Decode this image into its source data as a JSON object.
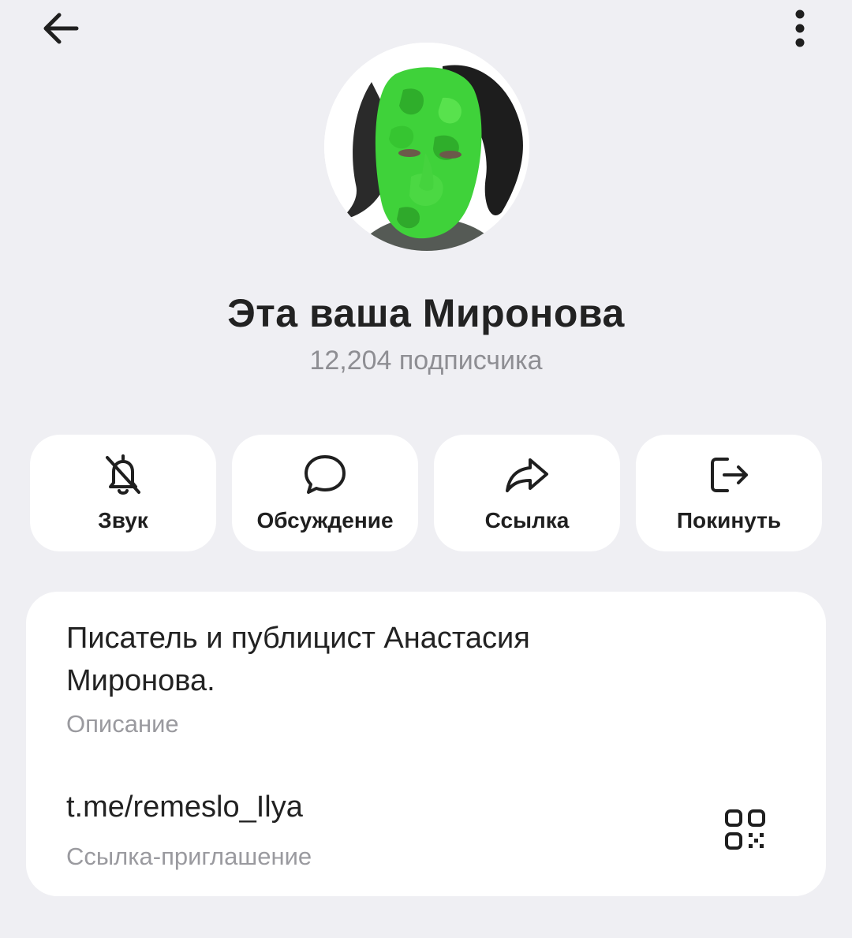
{
  "header": {
    "back_icon": "arrow-left-icon",
    "more_icon": "more-vertical-icon"
  },
  "channel": {
    "name": "Эта ваша Миронова",
    "subscribers": "12,204 подписчика"
  },
  "actions": [
    {
      "label": "Звук",
      "icon": "bell-off-icon"
    },
    {
      "label": "Обсуждение",
      "icon": "chat-bubble-icon"
    },
    {
      "label": "Ссылка",
      "icon": "share-icon"
    },
    {
      "label": "Покинуть",
      "icon": "exit-icon"
    }
  ],
  "info": {
    "description": "Писатель и публицист Анастасия Миронова.",
    "description_caption": "Описание",
    "link": "t.me/remeslo_Ilya",
    "link_caption": "Ссылка-приглашение",
    "qr_icon": "qr-code-icon"
  },
  "colors": {
    "background": "#efeff3",
    "card": "#ffffff",
    "text_primary": "#222222",
    "text_secondary": "#8e8e93",
    "avatar_mask": "#3fd23a"
  }
}
